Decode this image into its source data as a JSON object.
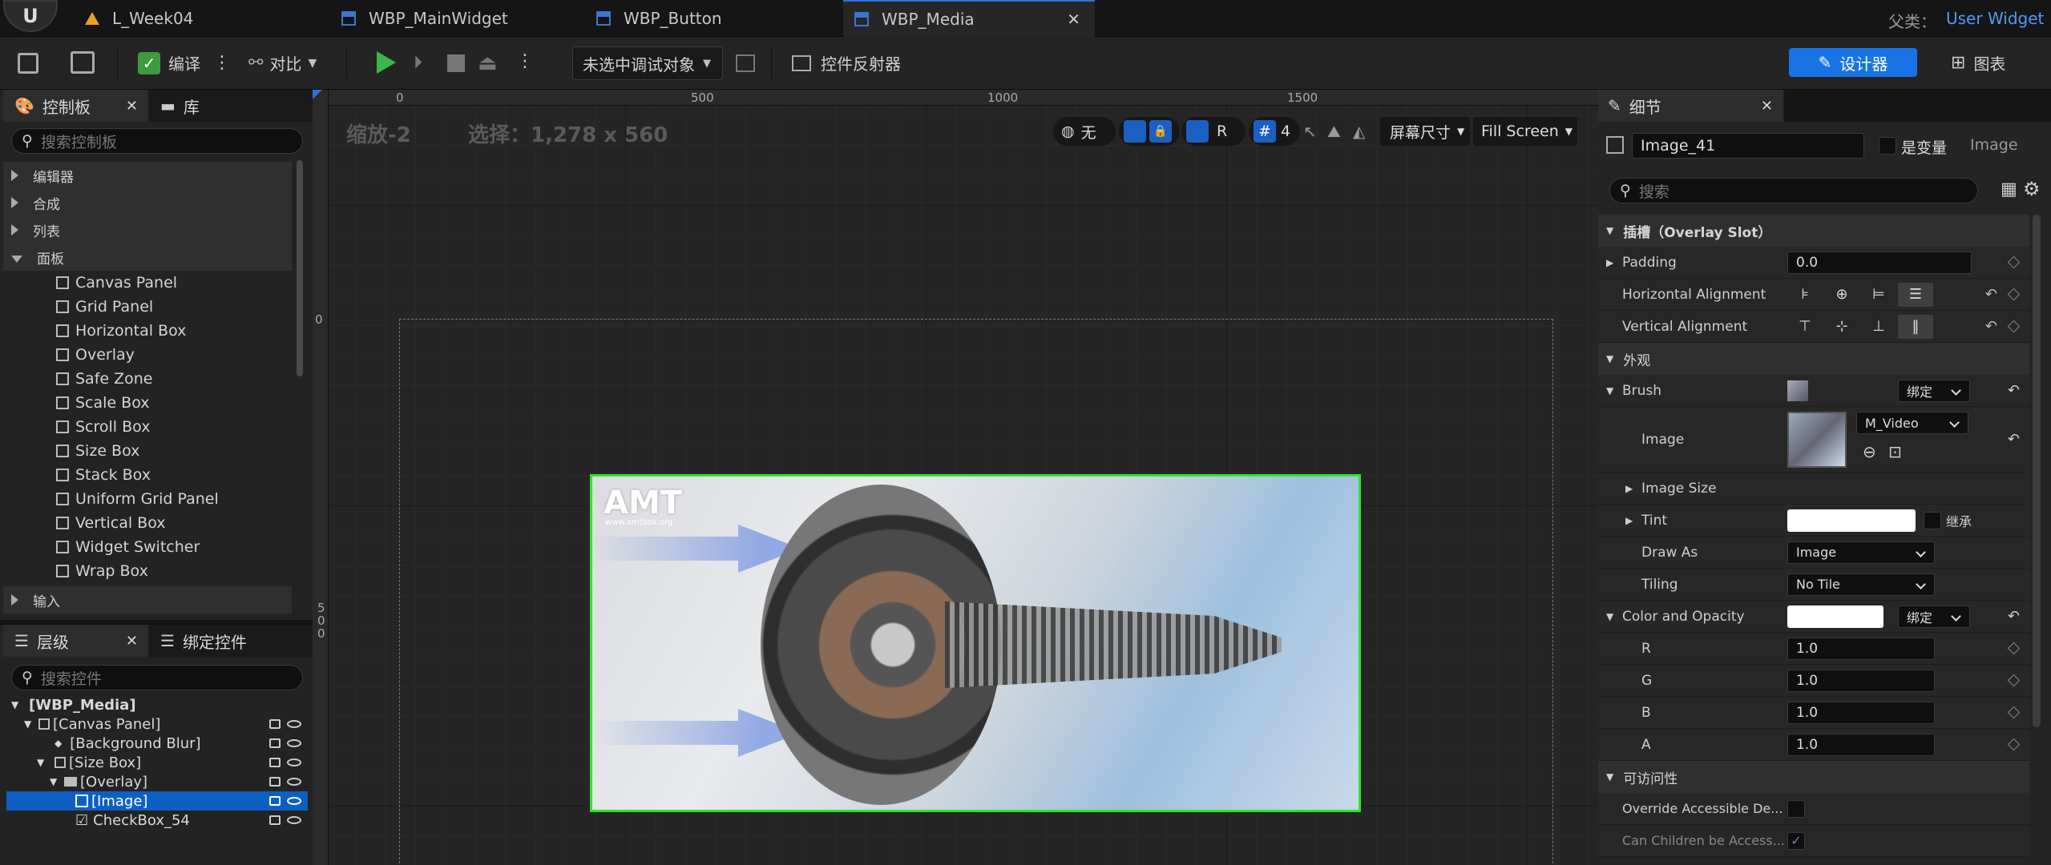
{
  "titlebar": {
    "tabs": [
      {
        "label": "L_Week04"
      },
      {
        "label": "WBP_MainWidget"
      },
      {
        "label": "WBP_Button"
      },
      {
        "label": "WBP_Media"
      }
    ],
    "parent_class_label": "父类：",
    "parent_class_value": "User Widget"
  },
  "toolbar": {
    "compile": "编译",
    "diff": "对比",
    "debug_select": "未选中调试对象",
    "widget_reflector": "控件反射器",
    "designer": "设计器",
    "graph": "图表"
  },
  "palette": {
    "tab_palette": "控制板",
    "tab_library": "库",
    "search_placeholder": "搜索控制板",
    "categories": [
      "编辑器",
      "合成",
      "列表",
      "面板"
    ],
    "panel_items": [
      "Canvas Panel",
      "Grid Panel",
      "Horizontal Box",
      "Overlay",
      "Safe Zone",
      "Scale Box",
      "Scroll Box",
      "Size Box",
      "Stack Box",
      "Uniform Grid Panel",
      "Vertical Box",
      "Widget Switcher",
      "Wrap Box"
    ],
    "after_category": "输入"
  },
  "hierarchy": {
    "tab_hierarchy": "层级",
    "tab_bind": "绑定控件",
    "search_placeholder": "搜索控件",
    "items": [
      "[WBP_Media]",
      "[Canvas Panel]",
      "[Background Blur]",
      "[Size Box]",
      "[Overlay]",
      "[Image]",
      "CheckBox_54"
    ]
  },
  "viewport": {
    "zoom": "缩放-2",
    "selection": "选择：1,278 x 560",
    "ruler_top": [
      "0",
      "500",
      "1000",
      "1500"
    ],
    "ruler_left": [
      "0",
      "5",
      "0",
      "0"
    ],
    "tools": {
      "none": "无",
      "r": "R",
      "grid": "4",
      "screen_size": "屏幕尺寸",
      "fill_screen": "Fill Screen"
    },
    "image_text": {
      "brand": "AMT",
      "url": "www.amtbox.org"
    }
  },
  "details": {
    "tab": "细节",
    "name_value": "Image_41",
    "is_variable": "是变量",
    "type": "Image",
    "search_placeholder": "搜索",
    "slot_section": "插槽（Overlay Slot）",
    "padding_label": "Padding",
    "padding_value": "0.0",
    "h_align_label": "Horizontal Alignment",
    "v_align_label": "Vertical Alignment",
    "appearance_section": "外观",
    "brush_label": "Brush",
    "bind_label": "绑定",
    "image_label": "Image",
    "image_value": "M_Video",
    "image_size_label": "Image Size",
    "tint_label": "Tint",
    "inherit_label": "继承",
    "draw_as_label": "Draw As",
    "draw_as_value": "Image",
    "tiling_label": "Tiling",
    "tiling_value": "No Tile",
    "color_opacity_label": "Color and Opacity",
    "r_label": "R",
    "r_value": "1.0",
    "g_label": "G",
    "g_value": "1.0",
    "b_label": "B",
    "b_value": "1.0",
    "a_label": "A",
    "a_value": "1.0",
    "accessibility_section": "可访问性",
    "override_label": "Override Accessible De...",
    "children_label": "Can Children be Access..."
  }
}
